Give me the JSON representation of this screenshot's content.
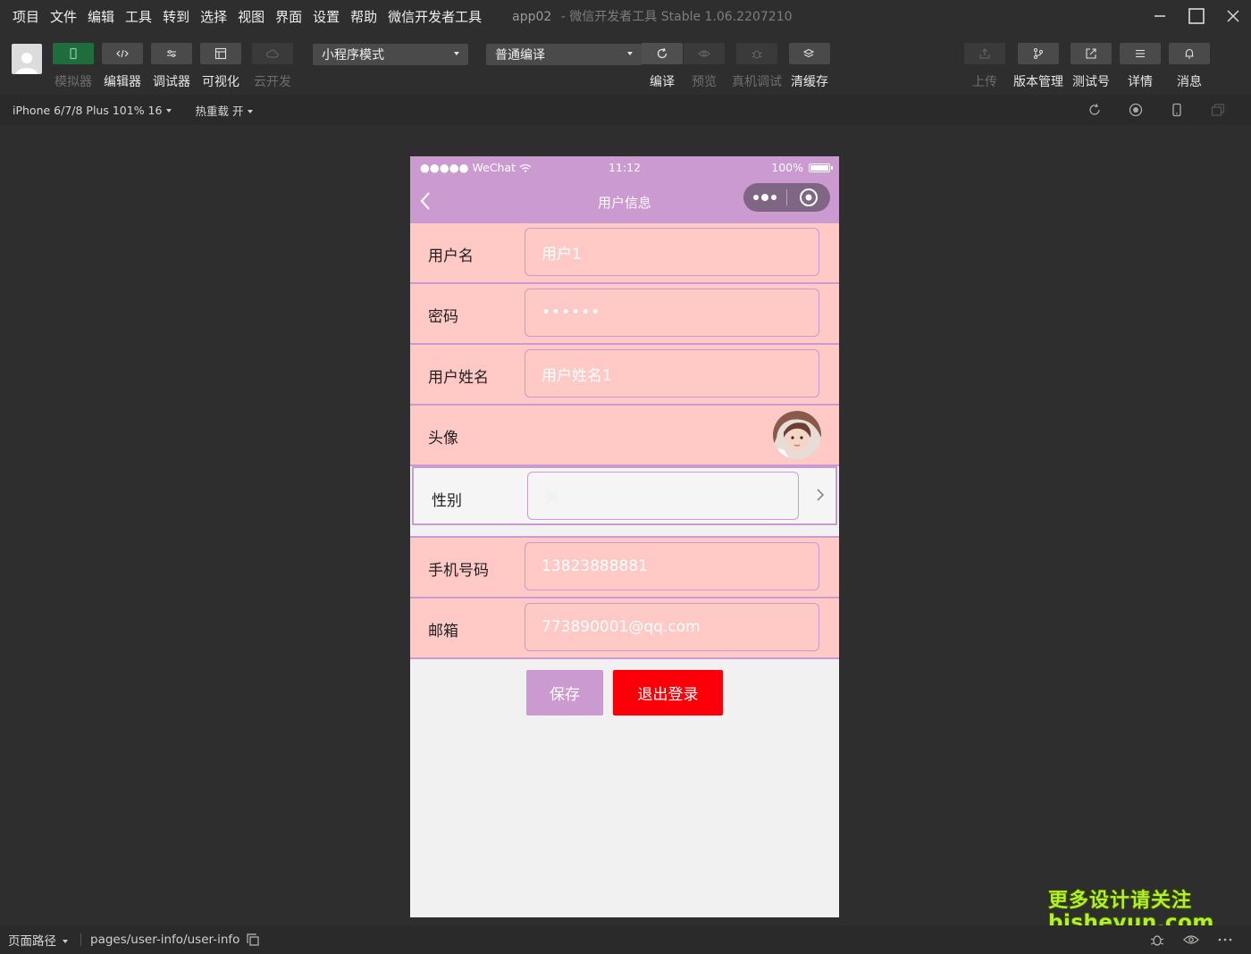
{
  "menubar": {
    "items": [
      "项目",
      "文件",
      "编辑",
      "工具",
      "转到",
      "选择",
      "视图",
      "界面",
      "设置",
      "帮助",
      "微信开发者工具"
    ],
    "app_name": "app02",
    "window_subtitle": "- 微信开发者工具 Stable 1.06.2207210"
  },
  "toolbar": {
    "simulator": "模拟器",
    "editor": "编辑器",
    "debugger": "调试器",
    "visual": "可视化",
    "cloud": "云开发",
    "mode_select": "小程序模式",
    "compile_select": "普通编译",
    "compile": "编译",
    "preview": "预览",
    "remote_debug": "真机调试",
    "clear_cache": "清缓存",
    "upload": "上传",
    "version_mgmt": "版本管理",
    "test_account": "测试号",
    "details": "详情",
    "messages": "消息"
  },
  "subbar": {
    "device": "iPhone 6/7/8 Plus 101% 16",
    "hot_reload": "热重载 开"
  },
  "phone": {
    "status": {
      "carrier": "●●●●● WeChat",
      "time": "11:12",
      "battery": "100%",
      "battery_level": 1.0
    },
    "nav_title": "用户信息",
    "form": {
      "username_label": "用户名",
      "username_value": "用户1",
      "password_label": "密码",
      "password_value": "••••••",
      "realname_label": "用户姓名",
      "realname_value": "用户姓名1",
      "avatar_label": "头像",
      "gender_label": "性别",
      "gender_value": "男",
      "phone_label": "手机号码",
      "phone_value": "13823888881",
      "email_label": "邮箱",
      "email_value": "773890001@qq.com"
    },
    "save_button": "保存",
    "logout_button": "退出登录"
  },
  "bottombar": {
    "path_label": "页面路径",
    "path_value": "pages/user-info/user-info"
  },
  "watermark": {
    "line1": "更多设计请关注",
    "line2": "bisheyun.com"
  },
  "colors": {
    "theme_purple": "#cb9ad0",
    "row_pink": "#ffc9c6",
    "logout_red": "#fb0008",
    "sim_active_green": "#1f6d3c"
  }
}
